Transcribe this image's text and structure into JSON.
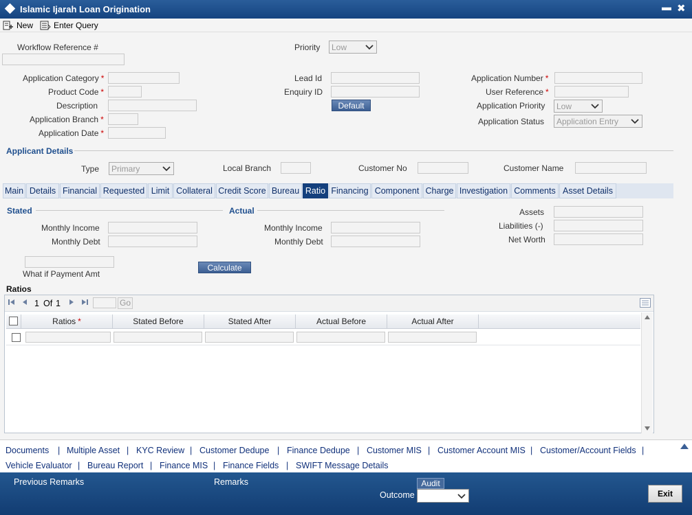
{
  "window": {
    "title": "Islamic Ijarah Loan Origination"
  },
  "toolbar": {
    "new_label": "New",
    "enter_query_label": "Enter Query"
  },
  "header": {
    "workflow_reference_label": "Workflow Reference #",
    "priority_label": "Priority",
    "priority_value": "Low",
    "application_category_label": "Application Category",
    "product_code_label": "Product Code",
    "description_label": "Description",
    "application_branch_label": "Application Branch",
    "application_date_label": "Application Date",
    "lead_id_label": "Lead Id",
    "enquiry_id_label": "Enquiry ID",
    "default_button": "Default",
    "application_number_label": "Application Number",
    "user_reference_label": "User Reference",
    "application_priority_label": "Application Priority",
    "application_priority_value": "Low",
    "application_status_label": "Application Status",
    "application_status_value": "Application Entry",
    "required_mark": "*"
  },
  "applicant": {
    "section_title": "Applicant Details",
    "type_label": "Type",
    "type_value": "Primary",
    "local_branch_label": "Local Branch",
    "customer_no_label": "Customer No",
    "customer_name_label": "Customer Name"
  },
  "tabs": [
    {
      "label": "Main"
    },
    {
      "label": "Details"
    },
    {
      "label": "Financial"
    },
    {
      "label": "Requested"
    },
    {
      "label": "Limit"
    },
    {
      "label": "Collateral"
    },
    {
      "label": "Credit Score"
    },
    {
      "label": "Bureau"
    },
    {
      "label": "Ratio"
    },
    {
      "label": "Financing"
    },
    {
      "label": "Component"
    },
    {
      "label": "Charge"
    },
    {
      "label": "Investigation"
    },
    {
      "label": "Comments"
    },
    {
      "label": "Asset Details"
    }
  ],
  "ratio_tab": {
    "stated_title": "Stated",
    "actual_title": "Actual",
    "monthly_income_label": "Monthly Income",
    "monthly_debt_label": "Monthly Debt",
    "assets_label": "Assets",
    "liabilities_label": "Liabilities (-)",
    "net_worth_label": "Net Worth",
    "what_if_label": "What if Payment Amt",
    "calculate_button": "Calculate",
    "ratios_title": "Ratios"
  },
  "grid": {
    "page_current": "1",
    "page_of": "Of",
    "page_total": "1",
    "go_label": "Go",
    "columns": [
      "Ratios",
      "Stated Before",
      "Stated After",
      "Actual Before",
      "Actual After"
    ]
  },
  "footer_links": [
    "Documents",
    "Multiple Asset",
    "KYC Review",
    "Customer Dedupe",
    "Finance Dedupe",
    "Customer MIS",
    "Customer Account MIS",
    "Customer/Account Fields",
    "Vehicle Evaluator",
    "Bureau Report",
    "Finance MIS",
    "Finance Fields",
    "SWIFT Message Details"
  ],
  "link_separator": "|",
  "bottom": {
    "previous_remarks_label": "Previous Remarks",
    "remarks_label": "Remarks",
    "audit_label": "Audit",
    "outcome_label": "Outcome",
    "exit_button": "Exit"
  }
}
